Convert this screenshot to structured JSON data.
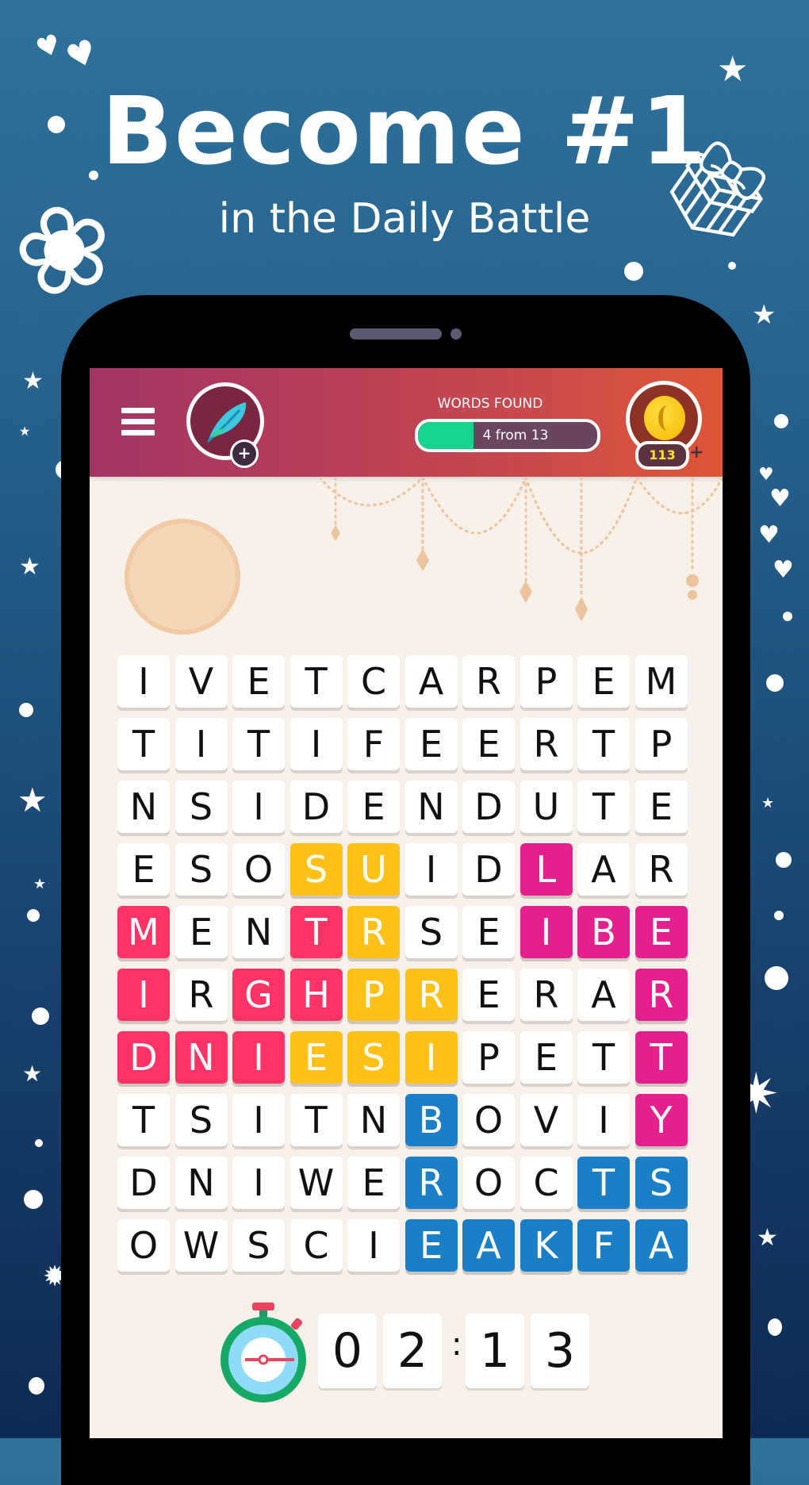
{
  "promo": {
    "headline": "Become #1",
    "subheadline": "in the Daily Battle"
  },
  "app_bar": {
    "menu_icon": "hamburger-menu-icon",
    "avatar_icon": "feather-icon",
    "avatar_add_label": "+",
    "words_found_label": "WORDS FOUND",
    "words_found_text": "4 from 13",
    "words_found": 4,
    "words_total": 13,
    "coins": "113",
    "coins_add_label": "+",
    "coin_icon": "moon-coin-icon"
  },
  "grid": {
    "rows": [
      [
        "I",
        "V",
        "E",
        "T",
        "C",
        "A",
        "R",
        "P",
        "E",
        "M"
      ],
      [
        "T",
        "I",
        "T",
        "I",
        "F",
        "E",
        "E",
        "R",
        "T",
        "P"
      ],
      [
        "N",
        "S",
        "I",
        "D",
        "E",
        "N",
        "D",
        "U",
        "T",
        "E"
      ],
      [
        "E",
        "S",
        "O",
        "S",
        "U",
        "I",
        "D",
        "L",
        "A",
        "R"
      ],
      [
        "M",
        "E",
        "N",
        "T",
        "R",
        "S",
        "E",
        "I",
        "B",
        "E"
      ],
      [
        "I",
        "R",
        "G",
        "H",
        "P",
        "R",
        "E",
        "R",
        "A",
        "R"
      ],
      [
        "D",
        "N",
        "I",
        "E",
        "S",
        "I",
        "P",
        "E",
        "T",
        "T"
      ],
      [
        "T",
        "S",
        "I",
        "T",
        "N",
        "B",
        "O",
        "V",
        "I",
        "Y"
      ],
      [
        "D",
        "N",
        "I",
        "W",
        "E",
        "R",
        "O",
        "C",
        "T",
        "S"
      ],
      [
        "O",
        "W",
        "S",
        "C",
        "I",
        "E",
        "A",
        "K",
        "F",
        "A"
      ]
    ],
    "found_words": [
      {
        "color": "#ff3366",
        "cells": [
          [
            4,
            0
          ],
          [
            5,
            0
          ],
          [
            6,
            0
          ],
          [
            6,
            1
          ],
          [
            6,
            2
          ],
          [
            5,
            2
          ],
          [
            5,
            3
          ],
          [
            4,
            3
          ]
        ]
      },
      {
        "color": "#ffc117",
        "cells": [
          [
            3,
            3
          ],
          [
            3,
            4
          ],
          [
            4,
            4
          ],
          [
            5,
            4
          ],
          [
            5,
            5
          ],
          [
            6,
            5
          ],
          [
            6,
            4
          ],
          [
            6,
            3
          ]
        ]
      },
      {
        "color": "#e61f8f",
        "cells": [
          [
            3,
            7
          ],
          [
            4,
            7
          ],
          [
            4,
            8
          ],
          [
            4,
            9
          ],
          [
            5,
            9
          ],
          [
            6,
            9
          ],
          [
            7,
            9
          ]
        ]
      },
      {
        "color": "#1a7fc7",
        "cells": [
          [
            7,
            5
          ],
          [
            8,
            5
          ],
          [
            9,
            5
          ],
          [
            9,
            6
          ],
          [
            9,
            7
          ],
          [
            9,
            8
          ],
          [
            9,
            9
          ],
          [
            8,
            9
          ],
          [
            8,
            8
          ]
        ]
      }
    ]
  },
  "timer": {
    "icon": "stopwatch-icon",
    "digits": [
      "0",
      "2",
      "1",
      "3"
    ],
    "separator": ":"
  }
}
